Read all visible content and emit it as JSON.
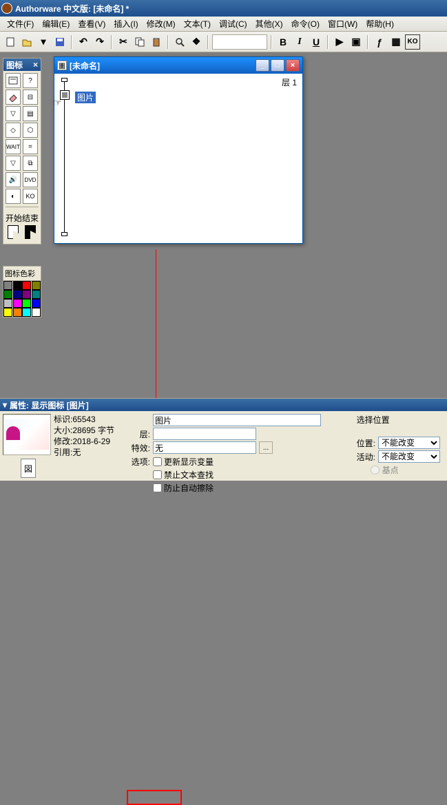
{
  "titlebar": {
    "text": "Authorware 中文版: [未命名] *"
  },
  "menu": {
    "file": "文件(F)",
    "edit": "编辑(E)",
    "view": "查看(V)",
    "insert": "插入(I)",
    "modify": "修改(M)",
    "text": "文本(T)",
    "debug": "调试(C)",
    "others": "其他(X)",
    "commands": "命令(O)",
    "window": "窗口(W)",
    "help": "帮助(H)"
  },
  "toolbar": {
    "bold": "B",
    "italic": "I",
    "underline": "U"
  },
  "palette": {
    "title": "图标",
    "start": "开始",
    "end": "结束",
    "color_label": "图标色彩",
    "colors": [
      "#808080",
      "#000000",
      "#ff0000",
      "#808000",
      "#008000",
      "#000080",
      "#800080",
      "#008080",
      "#c0c0c0",
      "#ff00ff",
      "#00ff00",
      "#0000ff",
      "#ffff00",
      "#ff8000",
      "#00ffff",
      "#ffffff"
    ]
  },
  "flowline": {
    "doc_title": "[未命名]",
    "level": "层 1",
    "node_label": "图片"
  },
  "props": {
    "header": "属性: 显示图标 [图片]",
    "id_label": "标识:",
    "id_value": "65543",
    "size_label": "大小:",
    "size_value": "28695 字节",
    "modified_label": "修改:",
    "modified_value": "2018-6-29",
    "ref_label": "引用:",
    "ref_value": "无",
    "name_value": "图片",
    "layer_label": "层:",
    "layer_value": "",
    "effect_label": "特效:",
    "effect_value": "无",
    "options_label": "选项:",
    "opt_update": "更新显示变量",
    "opt_no_text": "禁止文本查找",
    "opt_no_erase": "防止自动擦除",
    "choose_pos": "选择位置",
    "position_label": "位置:",
    "position_value": "不能改变",
    "active_label": "活动:",
    "active_value": "不能改变",
    "base_label": "基点"
  }
}
